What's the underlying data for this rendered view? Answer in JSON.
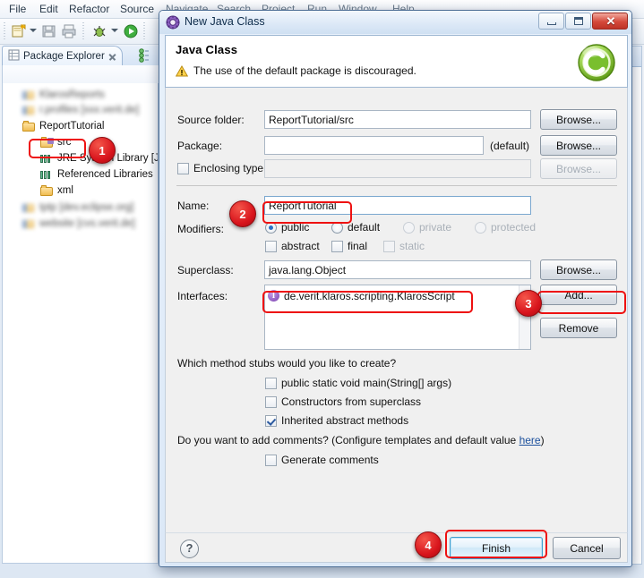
{
  "ide": {
    "menu": [
      "File",
      "Edit",
      "Refactor",
      "Source",
      "Navigate",
      "Search",
      "Project",
      "Run",
      "Window",
      "Help"
    ],
    "package_explorer": {
      "tab_label": "Package Explorer",
      "tree": [
        {
          "label": "KlarosReports",
          "type": "project",
          "blurred": true
        },
        {
          "label": "r.profiles  [xxx.verit.de]",
          "type": "project",
          "blurred": true
        },
        {
          "label": "ReportTutorial",
          "type": "project-open",
          "blurred": false
        },
        {
          "label": "src",
          "type": "source-folder",
          "blurred": false
        },
        {
          "label": "JRE System Library [J",
          "type": "library",
          "blurred": false
        },
        {
          "label": "Referenced Libraries",
          "type": "library",
          "blurred": false
        },
        {
          "label": "xml",
          "type": "folder",
          "blurred": false
        },
        {
          "label": "tptp  [dev.eclipse.org]",
          "type": "project",
          "blurred": true
        },
        {
          "label": "website  [cvs.verit.de]",
          "type": "project",
          "blurred": true
        }
      ]
    }
  },
  "dialog": {
    "title": "New Java Class",
    "window_buttons": {
      "minimize": "Minimize",
      "maximize": "Maximize",
      "close": "✕"
    },
    "header": {
      "title": "Java Class",
      "message": "The use of the default package is discouraged.",
      "icon": "class-wizard-banner-icon"
    },
    "fields": {
      "source_folder": {
        "label": "Source folder:",
        "value": "ReportTutorial/src",
        "browse": "Browse..."
      },
      "package": {
        "label": "Package:",
        "value": "",
        "suffix": "(default)",
        "browse": "Browse..."
      },
      "enclosing_type": {
        "label": "Enclosing type:",
        "value": "",
        "checked": false,
        "browse": "Browse...",
        "disabled": true
      },
      "name": {
        "label": "Name:",
        "value": "ReportTutorial"
      },
      "modifiers": {
        "label": "Modifiers:",
        "access": [
          {
            "label": "public",
            "selected": true,
            "disabled": false
          },
          {
            "label": "default",
            "selected": false,
            "disabled": false
          },
          {
            "label": "private",
            "selected": false,
            "disabled": true
          },
          {
            "label": "protected",
            "selected": false,
            "disabled": true
          }
        ],
        "extra": [
          {
            "label": "abstract",
            "checked": false,
            "disabled": false
          },
          {
            "label": "final",
            "checked": false,
            "disabled": false
          },
          {
            "label": "static",
            "checked": false,
            "disabled": true
          }
        ]
      },
      "superclass": {
        "label": "Superclass:",
        "value": "java.lang.Object",
        "browse": "Browse..."
      },
      "interfaces": {
        "label": "Interfaces:",
        "items": [
          "de.verit.klaros.scripting.KlarosScript"
        ],
        "add": "Add...",
        "remove": "Remove"
      }
    },
    "stubs": {
      "question": "Which method stubs would you like to create?",
      "options": [
        {
          "label": "public static void main(String[] args)",
          "checked": false
        },
        {
          "label": "Constructors from superclass",
          "checked": false
        },
        {
          "label": "Inherited abstract methods",
          "checked": true
        }
      ]
    },
    "comments": {
      "question_prefix": "Do you want to add comments? (Configure templates and default value ",
      "link": "here",
      "question_suffix": ")",
      "option": {
        "label": "Generate comments",
        "checked": false
      }
    },
    "footer": {
      "help": "?",
      "finish": "Finish",
      "cancel": "Cancel"
    }
  },
  "annotations": {
    "badges": [
      {
        "number": "1",
        "target": "src-tree-node"
      },
      {
        "number": "2",
        "target": "name-field"
      },
      {
        "number": "3",
        "target": "add-interface-button"
      },
      {
        "number": "4",
        "target": "finish-button"
      }
    ],
    "highlight_color": "#ee1111",
    "badge_color": "#d8141c"
  }
}
